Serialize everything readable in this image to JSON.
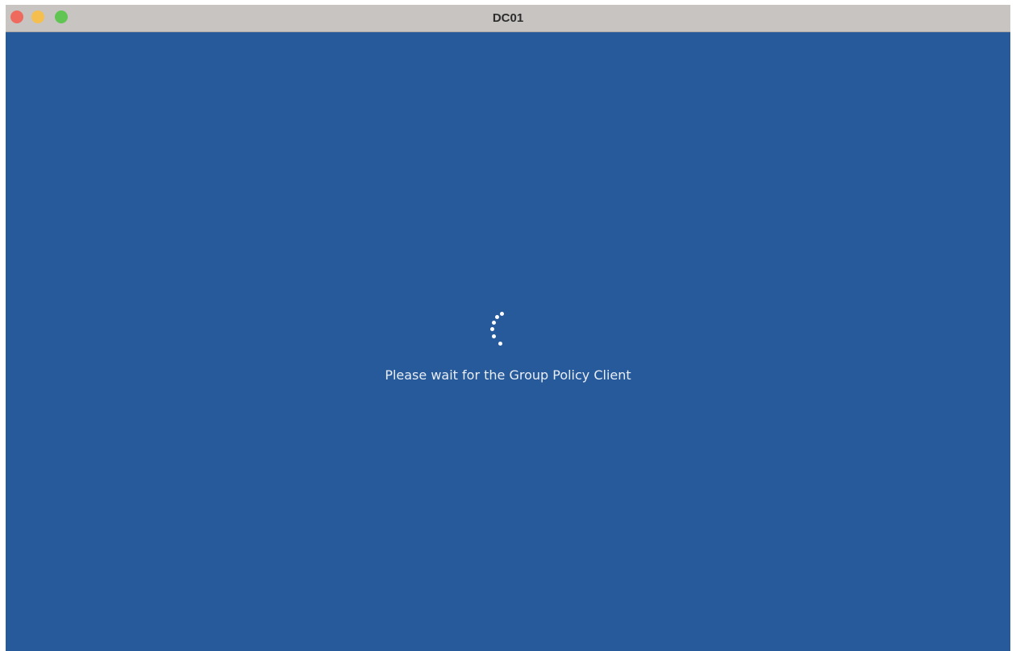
{
  "window": {
    "title": "DC01",
    "controls": {
      "close_color": "#ee6a5f",
      "minimize_color": "#f5bf4f",
      "zoom_color": "#61c554"
    }
  },
  "screen": {
    "background_color": "#275a9a",
    "spinner_icon": "loading-spinner-icon",
    "message": "Please wait for the Group Policy Client"
  }
}
